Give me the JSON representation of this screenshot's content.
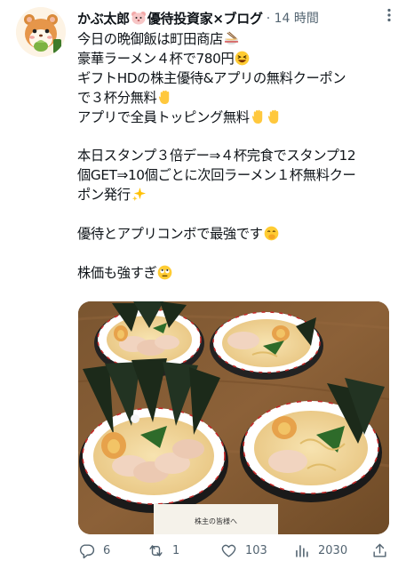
{
  "author": {
    "name_part1": "かぶ太郎",
    "name_part2": "優待投資家×ブログ",
    "separator": " · ",
    "time": "14 時間",
    "more_label": "⋮"
  },
  "tweet": {
    "lines": [
      "今日の晩御飯は町田商店",
      "豪華ラーメン４杯で780円",
      "ギフトHDの株主優待&アプリの無料クーポン",
      "で３杯分無料",
      "アプリで全員トッピング無料",
      "",
      "本日スタンプ３倍デー⇒４杯完食でスタンプ12",
      "個GET⇒10個ごとに次回ラーメン１杯無料クー",
      "ポン発行",
      "",
      "優待とアプリコンボで最強です",
      "",
      "株価も強すぎ"
    ]
  },
  "image": {
    "sign_text": "株主の皆様へ"
  },
  "actions": {
    "replies": "6",
    "retweets": "1",
    "likes": "103",
    "views": "2030"
  },
  "colors": {
    "text": "#0f1419",
    "secondary": "#536471",
    "broth": "#f0d9a0",
    "bowl": "#ffffff"
  }
}
